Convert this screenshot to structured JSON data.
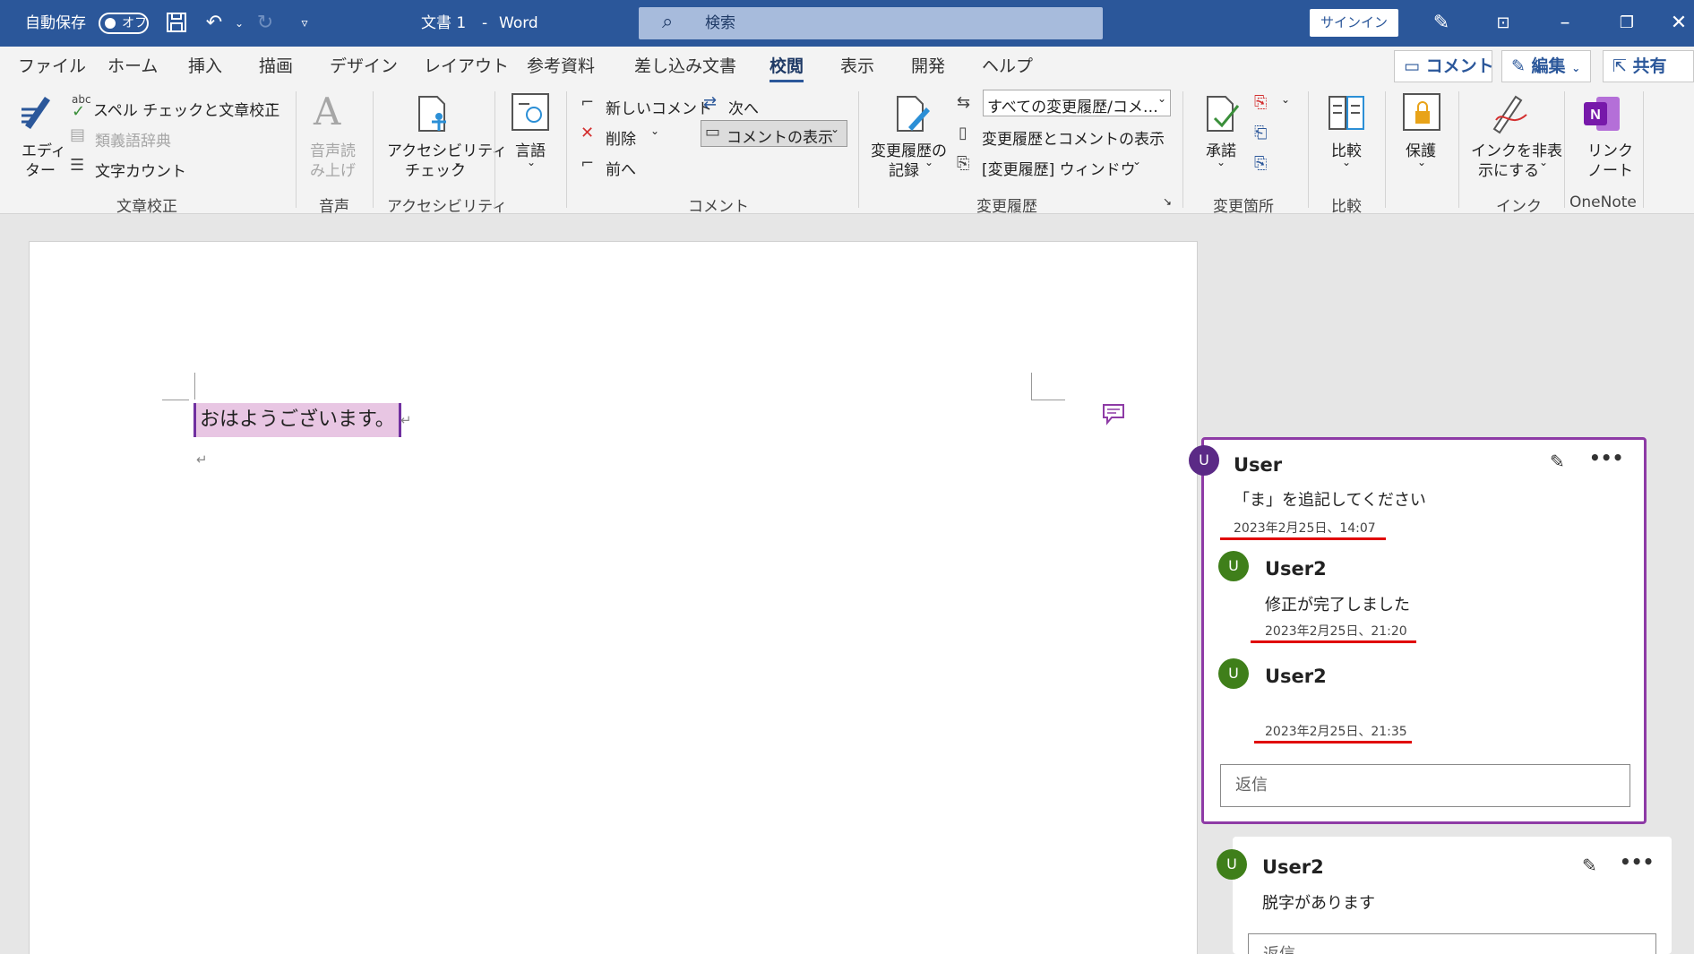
{
  "titlebar": {
    "autosave_label": "自動保存",
    "autosave_state": "オフ",
    "doc_title": "文書 1",
    "separator": "-",
    "app_name": "Word",
    "search_placeholder": "検索",
    "signin_label": "サインイン"
  },
  "tabs": [
    "ファイル",
    "ホーム",
    "挿入",
    "描画",
    "デザイン",
    "レイアウト",
    "参考資料",
    "差し込み文書",
    "校閲",
    "表示",
    "開発",
    "ヘルプ"
  ],
  "active_tab": "校閲",
  "right_buttons": {
    "comment": "コメント",
    "edit": "編集",
    "share": "共有"
  },
  "ribbon": {
    "proofing": {
      "editor_line1": "エディ",
      "editor_line2": "ター",
      "spell_check": "スペル チェックと文章校正",
      "thesaurus": "類義語辞典",
      "word_count": "文字カウント",
      "group": "文章校正"
    },
    "speech": {
      "read_line1": "音声読",
      "read_line2": "み上げ",
      "group": "音声"
    },
    "accessibility": {
      "check_line1": "アクセシビリティ",
      "check_line2": "チェック",
      "group": "アクセシビリティ"
    },
    "language": {
      "label": "言語"
    },
    "comments": {
      "new_comment": "新しいコメント",
      "next": "次へ",
      "delete": "削除",
      "show_comments": "コメントの表示",
      "previous": "前へ",
      "group": "コメント"
    },
    "tracking": {
      "track_line1": "変更履歴の",
      "track_line2": "記録",
      "markup_dropdown": "すべての変更履歴/コメ…",
      "show_markup": "変更履歴とコメントの表示",
      "reviewing_pane": "[変更履歴] ウィンドウ",
      "group": "変更履歴"
    },
    "changes": {
      "accept": "承諾",
      "group": "変更箇所"
    },
    "compare": {
      "label": "比較",
      "group": "比較"
    },
    "protect": {
      "label": "保護"
    },
    "ink": {
      "hide_line1": "インクを非表",
      "hide_line2": "示にする",
      "group": "インク"
    },
    "onenote": {
      "link_line1": "リンク",
      "link_line2": "ノート",
      "group": "OneNote"
    }
  },
  "document": {
    "text": "おはようございます。"
  },
  "comments": [
    {
      "author": "User",
      "avatar": "U",
      "text": "「ま」を追記してください",
      "date": "2023年2月25日、14:07",
      "replies": [
        {
          "author": "User2",
          "avatar": "U",
          "text": "修正が完了しました",
          "date": "2023年2月25日、21:20"
        },
        {
          "author": "User2",
          "avatar": "U",
          "text": "",
          "date": "2023年2月25日、21:35"
        }
      ],
      "reply_placeholder": "返信"
    },
    {
      "author": "User2",
      "avatar": "U",
      "text": "脱字があります",
      "reply_placeholder": "返信"
    }
  ],
  "colors": {
    "word_blue": "#2b579a",
    "comment_border": "#8e3ba6",
    "user_avatar": "#5b2a86",
    "user2_avatar": "#3f7f1a",
    "highlight": "#e8c6e3",
    "annotation_red": "#e00000"
  }
}
